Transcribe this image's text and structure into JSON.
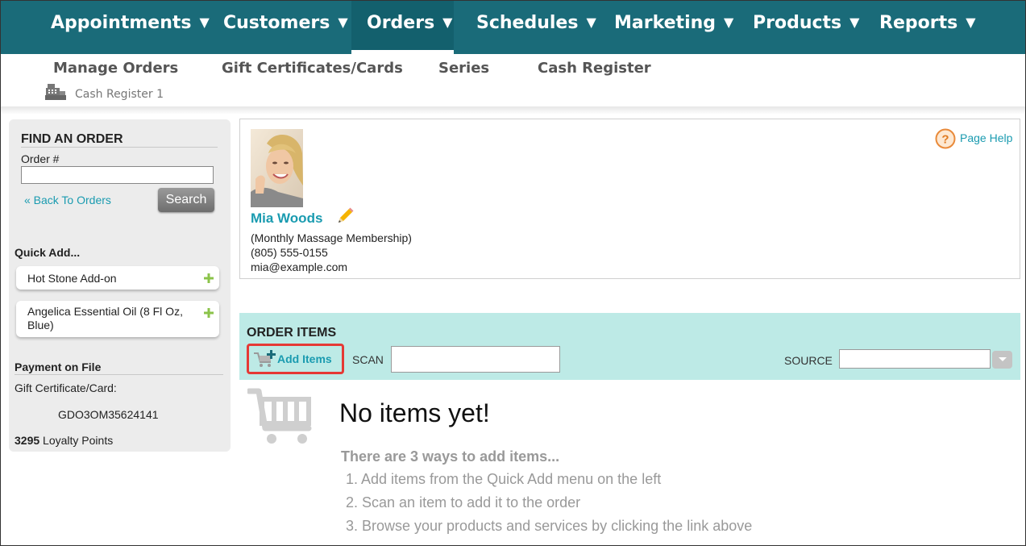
{
  "nav": {
    "items": [
      {
        "label": "Appointments",
        "caret": "▼"
      },
      {
        "label": "Customers",
        "caret": "▼"
      },
      {
        "label": "Orders",
        "caret": "▼"
      },
      {
        "label": "Schedules",
        "caret": "▼"
      },
      {
        "label": "Marketing",
        "caret": "▼"
      },
      {
        "label": "Products",
        "caret": "▼"
      },
      {
        "label": "Reports",
        "caret": "▼"
      }
    ],
    "active": "Orders"
  },
  "subnav": {
    "items": [
      "Manage Orders",
      "Gift Certificates/Cards",
      "Series",
      "Cash Register"
    ],
    "register_label": "Cash Register 1"
  },
  "sidebar": {
    "find_title": "FIND AN ORDER",
    "order_label": "Order #",
    "order_value": "",
    "back_link": "«  Back To Orders",
    "search_button": "Search",
    "quick_add_title": "Quick Add...",
    "quick_add_items": [
      "Hot Stone Add-on",
      "Angelica Essential Oil (8 Fl Oz, Blue)"
    ],
    "payment_title": "Payment on File",
    "gift_card_label": "Gift Certificate/Card:",
    "gift_card_code": "GDO3OM35624141",
    "loyalty_points": "3295",
    "loyalty_label": "Loyalty Points"
  },
  "customer": {
    "name": "Mia Woods",
    "membership": "(Monthly Massage Membership)",
    "phone": "(805) 555-0155",
    "email": "mia@example.com",
    "page_help": "Page Help"
  },
  "order_items": {
    "title": "ORDER ITEMS",
    "add_items": "Add Items",
    "scan_label": "SCAN",
    "scan_value": "",
    "source_label": "SOURCE",
    "source_value": ""
  },
  "empty_state": {
    "title": "No items yet!",
    "ways_title": "There are 3 ways to add items...",
    "ways": [
      "1. Add items from the Quick Add menu on the left",
      "2. Scan an item to add it to the order",
      "3. Browse your products and services by clicking the link above"
    ]
  },
  "colors": {
    "nav_bg": "#1a6b79",
    "link": "#1a9bb0",
    "order_bar_bg": "#bdeae6",
    "highlight": "#e53935"
  },
  "icons": [
    "cash-register-icon",
    "plus-icon",
    "pencil-icon",
    "help-icon",
    "cart-plus-icon",
    "cart-icon",
    "chevron-down-icon"
  ]
}
